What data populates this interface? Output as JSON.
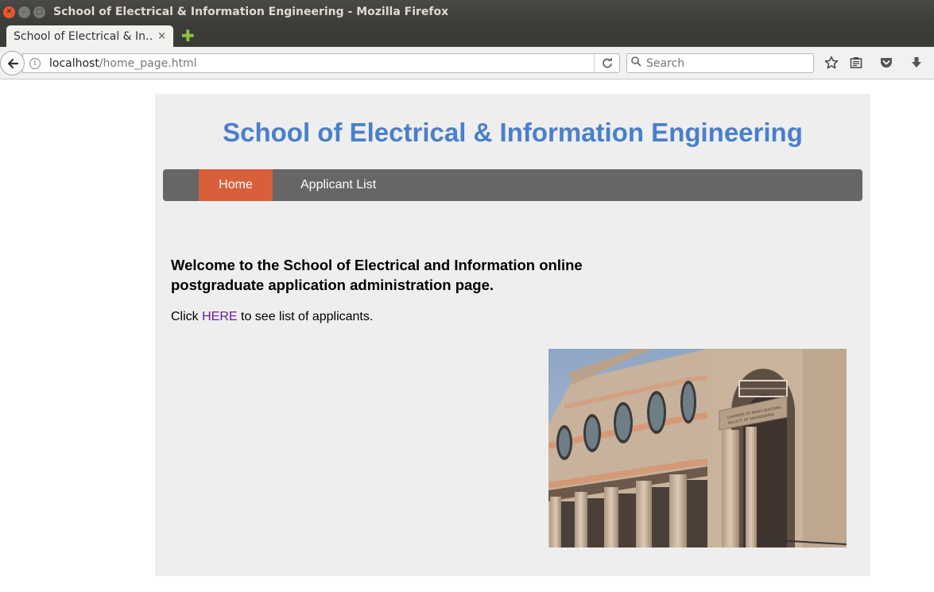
{
  "window": {
    "title": "School of Electrical & Information Engineering - Mozilla Firefox"
  },
  "tab": {
    "title": "School of Electrical & In…",
    "close_glyph": "×",
    "new_tab_glyph": "✚"
  },
  "navbar": {
    "url_host": "localhost",
    "url_path": "/home_page.html",
    "search_placeholder": "Search"
  },
  "page": {
    "site_title": "School of Electrical & Information Engineering",
    "menu": {
      "home_label": "Home",
      "applicant_list_label": "Applicant List"
    },
    "welcome_text": "Welcome to the School of Electrical and Information online postgraduate application administration page.",
    "click_prefix": "Click ",
    "here_link": "HERE",
    "click_suffix": " to see list of applicants.",
    "building_sign_line1": "CHAMBER OF MINES BUILDING",
    "building_sign_line2": "FACULTY OF ENGINEERING"
  },
  "colors": {
    "title_blue": "#4a7fcb",
    "menu_bar": "#666666",
    "menu_active": "#d95f3b",
    "panel_bg": "#eeeeee",
    "visited_link": "#6a1b9a"
  },
  "icons": {
    "back": "back-arrow-icon",
    "info": "info-icon",
    "reload": "reload-icon",
    "search": "search-icon",
    "bookmark": "star-icon",
    "reading_list": "reading-list-icon",
    "pocket": "pocket-icon",
    "downloads": "download-icon"
  }
}
